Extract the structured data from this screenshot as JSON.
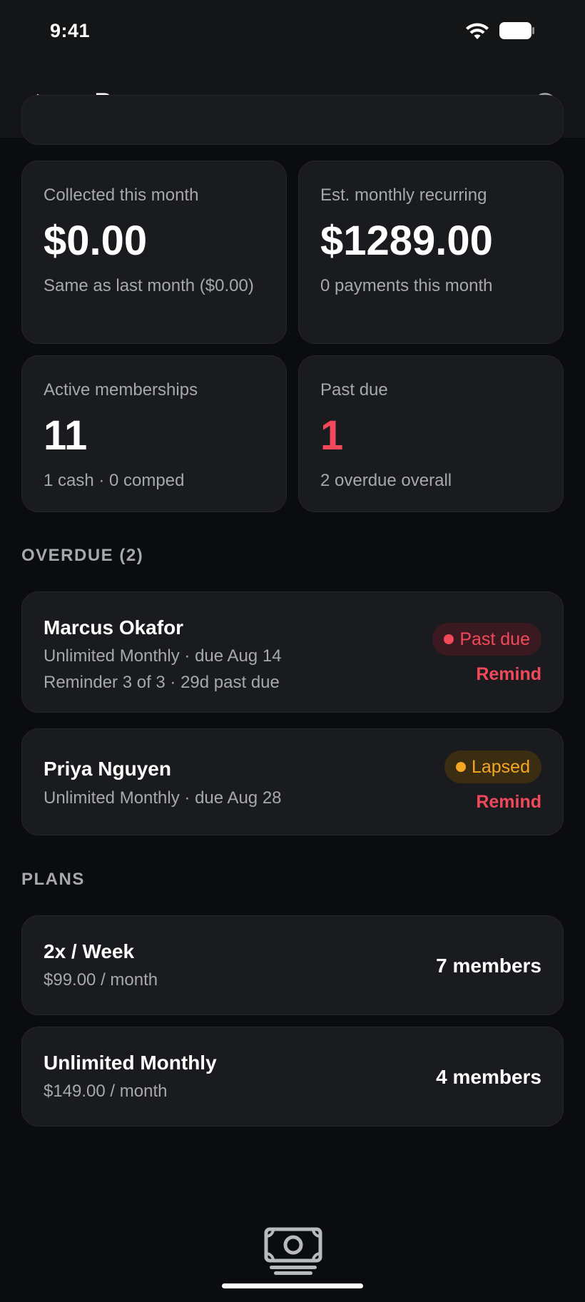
{
  "status_bar": {
    "time": "9:41"
  },
  "nav": {
    "title": "Revenue"
  },
  "stats": {
    "collected": {
      "label": "Collected this month",
      "value": "$0.00",
      "sub": "Same as last month ($0.00)"
    },
    "recurring": {
      "label": "Est. monthly recurring",
      "value": "$1289.00",
      "sub": "0 payments this month"
    },
    "active": {
      "label": "Active memberships",
      "value": "11",
      "sub": "1 cash · 0 comped"
    },
    "past_due": {
      "label": "Past due",
      "value": "1",
      "sub": "2 overdue overall"
    }
  },
  "overdue": {
    "header": "OVERDUE (2)",
    "items": [
      {
        "name": "Marcus Okafor",
        "line1": "Unlimited Monthly · due Aug 14",
        "line2": "Reminder 3 of 3 · 29d past due",
        "badge": "Past due",
        "action": "Remind"
      },
      {
        "name": "Priya Nguyen",
        "line1": "Unlimited Monthly · due Aug 28",
        "badge": "Lapsed",
        "action": "Remind"
      }
    ]
  },
  "plans": {
    "header": "PLANS",
    "items": [
      {
        "name": "2x / Week",
        "price": "$99.00 / month",
        "members": "7 members"
      },
      {
        "name": "Unlimited Monthly",
        "price": "$149.00 / month",
        "members": "4 members"
      }
    ]
  },
  "colors": {
    "accent_red": "#f1495a",
    "accent_amber": "#f5a623",
    "card_bg": "#1a1b1f",
    "page_bg": "#0b0c0f"
  },
  "tab_bar": {
    "icon": "money-icon"
  }
}
